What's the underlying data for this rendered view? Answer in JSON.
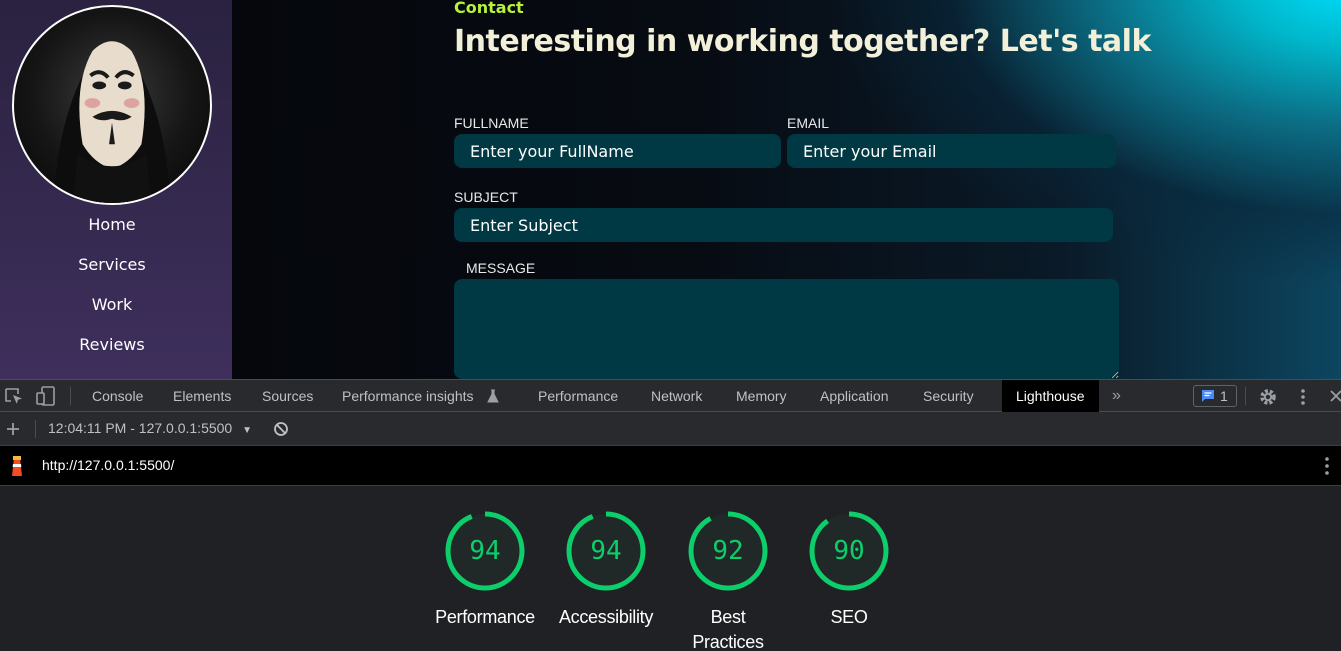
{
  "sidebar": {
    "nav": [
      "Home",
      "Services",
      "Work",
      "Reviews"
    ]
  },
  "contact": {
    "label": "Contact",
    "title": "Interesting in working together? Let's talk",
    "fullname": {
      "label": "FULLNAME",
      "placeholder": "Enter your FullName"
    },
    "email": {
      "label": "EMAIL",
      "placeholder": "Enter your Email"
    },
    "subject": {
      "label": "SUBJECT",
      "placeholder": "Enter Subject"
    },
    "message": {
      "label": "MESSAGE",
      "placeholder": ""
    }
  },
  "devtools": {
    "tabs": [
      "Console",
      "Elements",
      "Sources",
      "Performance insights",
      "Performance",
      "Network",
      "Memory",
      "Application",
      "Security",
      "Lighthouse"
    ],
    "active_tab": "Lighthouse",
    "issues_count": "1",
    "report_selector": "12:04:11 PM - 127.0.0.1:5500",
    "report_url": "http://127.0.0.1:5500/"
  },
  "lighthouse": {
    "color_pass": "#0cce6b",
    "scores": [
      {
        "label": "Performance",
        "value": 94
      },
      {
        "label": "Accessibility",
        "value": 94
      },
      {
        "label": "Best Practices",
        "value": 92
      },
      {
        "label": "SEO",
        "value": 90
      }
    ]
  }
}
